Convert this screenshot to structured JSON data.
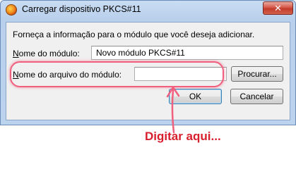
{
  "window": {
    "title": "Carregar dispositivo PKCS#11",
    "close_glyph": "✕"
  },
  "form": {
    "description": "Forneça a informação para o módulo que você deseja adicionar.",
    "module_name_label": "Nome do módulo:",
    "module_name_value": "Novo módulo PKCS#11",
    "module_file_label": "Nome do arquivo do módulo:",
    "module_file_value": "",
    "browse_label": "Procurar...",
    "ok_label": "OK",
    "cancel_label": "Cancelar"
  },
  "annotation": {
    "text": "Digitar aqui...",
    "color": "#d81e2c",
    "highlight_color": "#f0607e"
  },
  "icons": {
    "app": "firefox-icon",
    "close": "close-icon"
  }
}
